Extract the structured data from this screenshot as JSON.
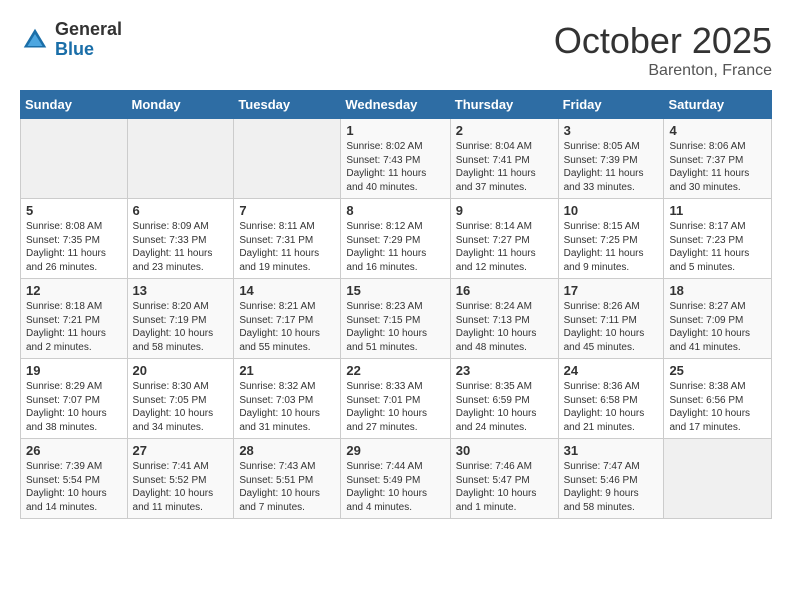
{
  "logo": {
    "general": "General",
    "blue": "Blue"
  },
  "title": "October 2025",
  "location": "Barenton, France",
  "days_of_week": [
    "Sunday",
    "Monday",
    "Tuesday",
    "Wednesday",
    "Thursday",
    "Friday",
    "Saturday"
  ],
  "weeks": [
    [
      {
        "day": "",
        "info": ""
      },
      {
        "day": "",
        "info": ""
      },
      {
        "day": "",
        "info": ""
      },
      {
        "day": "1",
        "info": "Sunrise: 8:02 AM\nSunset: 7:43 PM\nDaylight: 11 hours\nand 40 minutes."
      },
      {
        "day": "2",
        "info": "Sunrise: 8:04 AM\nSunset: 7:41 PM\nDaylight: 11 hours\nand 37 minutes."
      },
      {
        "day": "3",
        "info": "Sunrise: 8:05 AM\nSunset: 7:39 PM\nDaylight: 11 hours\nand 33 minutes."
      },
      {
        "day": "4",
        "info": "Sunrise: 8:06 AM\nSunset: 7:37 PM\nDaylight: 11 hours\nand 30 minutes."
      }
    ],
    [
      {
        "day": "5",
        "info": "Sunrise: 8:08 AM\nSunset: 7:35 PM\nDaylight: 11 hours\nand 26 minutes."
      },
      {
        "day": "6",
        "info": "Sunrise: 8:09 AM\nSunset: 7:33 PM\nDaylight: 11 hours\nand 23 minutes."
      },
      {
        "day": "7",
        "info": "Sunrise: 8:11 AM\nSunset: 7:31 PM\nDaylight: 11 hours\nand 19 minutes."
      },
      {
        "day": "8",
        "info": "Sunrise: 8:12 AM\nSunset: 7:29 PM\nDaylight: 11 hours\nand 16 minutes."
      },
      {
        "day": "9",
        "info": "Sunrise: 8:14 AM\nSunset: 7:27 PM\nDaylight: 11 hours\nand 12 minutes."
      },
      {
        "day": "10",
        "info": "Sunrise: 8:15 AM\nSunset: 7:25 PM\nDaylight: 11 hours\nand 9 minutes."
      },
      {
        "day": "11",
        "info": "Sunrise: 8:17 AM\nSunset: 7:23 PM\nDaylight: 11 hours\nand 5 minutes."
      }
    ],
    [
      {
        "day": "12",
        "info": "Sunrise: 8:18 AM\nSunset: 7:21 PM\nDaylight: 11 hours\nand 2 minutes."
      },
      {
        "day": "13",
        "info": "Sunrise: 8:20 AM\nSunset: 7:19 PM\nDaylight: 10 hours\nand 58 minutes."
      },
      {
        "day": "14",
        "info": "Sunrise: 8:21 AM\nSunset: 7:17 PM\nDaylight: 10 hours\nand 55 minutes."
      },
      {
        "day": "15",
        "info": "Sunrise: 8:23 AM\nSunset: 7:15 PM\nDaylight: 10 hours\nand 51 minutes."
      },
      {
        "day": "16",
        "info": "Sunrise: 8:24 AM\nSunset: 7:13 PM\nDaylight: 10 hours\nand 48 minutes."
      },
      {
        "day": "17",
        "info": "Sunrise: 8:26 AM\nSunset: 7:11 PM\nDaylight: 10 hours\nand 45 minutes."
      },
      {
        "day": "18",
        "info": "Sunrise: 8:27 AM\nSunset: 7:09 PM\nDaylight: 10 hours\nand 41 minutes."
      }
    ],
    [
      {
        "day": "19",
        "info": "Sunrise: 8:29 AM\nSunset: 7:07 PM\nDaylight: 10 hours\nand 38 minutes."
      },
      {
        "day": "20",
        "info": "Sunrise: 8:30 AM\nSunset: 7:05 PM\nDaylight: 10 hours\nand 34 minutes."
      },
      {
        "day": "21",
        "info": "Sunrise: 8:32 AM\nSunset: 7:03 PM\nDaylight: 10 hours\nand 31 minutes."
      },
      {
        "day": "22",
        "info": "Sunrise: 8:33 AM\nSunset: 7:01 PM\nDaylight: 10 hours\nand 27 minutes."
      },
      {
        "day": "23",
        "info": "Sunrise: 8:35 AM\nSunset: 6:59 PM\nDaylight: 10 hours\nand 24 minutes."
      },
      {
        "day": "24",
        "info": "Sunrise: 8:36 AM\nSunset: 6:58 PM\nDaylight: 10 hours\nand 21 minutes."
      },
      {
        "day": "25",
        "info": "Sunrise: 8:38 AM\nSunset: 6:56 PM\nDaylight: 10 hours\nand 17 minutes."
      }
    ],
    [
      {
        "day": "26",
        "info": "Sunrise: 7:39 AM\nSunset: 5:54 PM\nDaylight: 10 hours\nand 14 minutes."
      },
      {
        "day": "27",
        "info": "Sunrise: 7:41 AM\nSunset: 5:52 PM\nDaylight: 10 hours\nand 11 minutes."
      },
      {
        "day": "28",
        "info": "Sunrise: 7:43 AM\nSunset: 5:51 PM\nDaylight: 10 hours\nand 7 minutes."
      },
      {
        "day": "29",
        "info": "Sunrise: 7:44 AM\nSunset: 5:49 PM\nDaylight: 10 hours\nand 4 minutes."
      },
      {
        "day": "30",
        "info": "Sunrise: 7:46 AM\nSunset: 5:47 PM\nDaylight: 10 hours\nand 1 minute."
      },
      {
        "day": "31",
        "info": "Sunrise: 7:47 AM\nSunset: 5:46 PM\nDaylight: 9 hours\nand 58 minutes."
      },
      {
        "day": "",
        "info": ""
      }
    ]
  ]
}
